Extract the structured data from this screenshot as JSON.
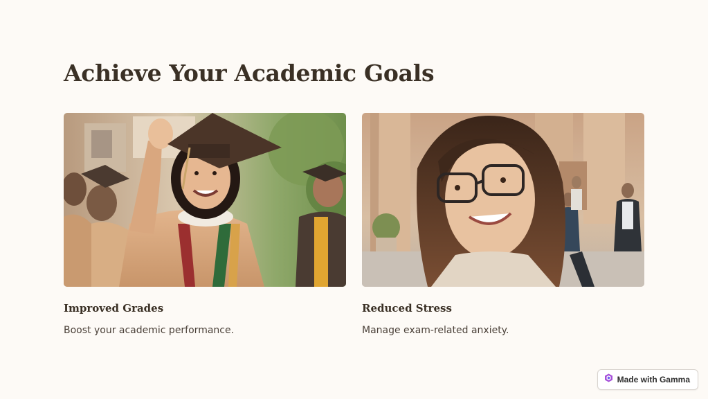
{
  "page": {
    "title": "Achieve Your Academic Goals"
  },
  "cards": [
    {
      "title": "Improved Grades",
      "description": "Boost your academic performance.",
      "image_subject": "graduate-celebrating-photo"
    },
    {
      "title": "Reduced Stress",
      "description": "Manage exam-related anxiety.",
      "image_subject": "smiling-student-glasses-photo"
    }
  ],
  "badge": {
    "label": "Made with Gamma",
    "icon": "gamma-logo-icon",
    "accent_color": "#a64fd9"
  },
  "colors": {
    "background": "#fdfaf6",
    "heading": "#3a3025",
    "body_text": "#4a4038"
  }
}
